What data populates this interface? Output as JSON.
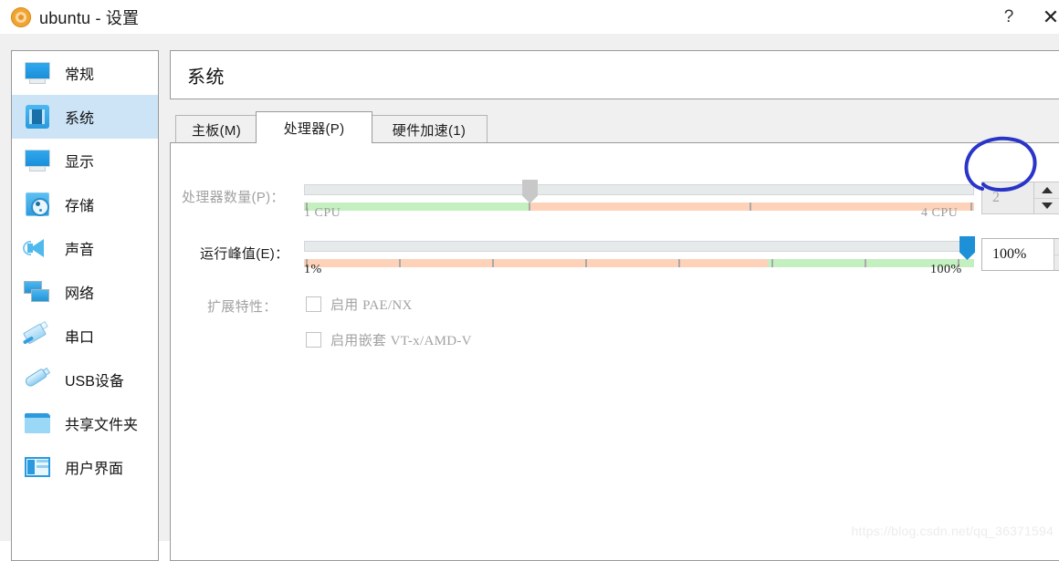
{
  "window": {
    "title": "ubuntu - 设置",
    "icon": "vbox-gear-icon",
    "help_label": "?",
    "close_label": "✕"
  },
  "sidebar": {
    "items": [
      {
        "label": "常规",
        "icon": "monitor-icon",
        "selected": false
      },
      {
        "label": "系统",
        "icon": "cpu-chip-icon",
        "selected": true
      },
      {
        "label": "显示",
        "icon": "monitor-icon",
        "selected": false
      },
      {
        "label": "存储",
        "icon": "hard-disk-icon",
        "selected": false
      },
      {
        "label": "声音",
        "icon": "speaker-icon",
        "selected": false
      },
      {
        "label": "网络",
        "icon": "network-cards-icon",
        "selected": false
      },
      {
        "label": "串口",
        "icon": "serial-port-icon",
        "selected": false
      },
      {
        "label": "USB设备",
        "icon": "usb-icon",
        "selected": false
      },
      {
        "label": "共享文件夹",
        "icon": "folder-icon",
        "selected": false
      },
      {
        "label": "用户界面",
        "icon": "window-layout-icon",
        "selected": false
      }
    ]
  },
  "header": {
    "title": "系统"
  },
  "tabs": [
    {
      "label": "主板(M)",
      "active": false
    },
    {
      "label": "处理器(P)",
      "active": true
    },
    {
      "label": "硬件加速(1)",
      "active": false
    }
  ],
  "main": {
    "cpu_count": {
      "label": "处理器数量(P)：",
      "enabled": false,
      "min_label": "1 CPU",
      "max_label": "4 CPU",
      "value": "2",
      "slider_percent": 33
    },
    "exec_cap": {
      "label": "运行峰值(E)：",
      "enabled": true,
      "min_label": "1%",
      "max_label": "100%",
      "value": "100%",
      "slider_percent": 100
    },
    "extended_features": {
      "label": "扩展特性：",
      "checkboxes": [
        {
          "label_cn": "启用",
          "label_mono": "PAE/NX",
          "checked": false
        },
        {
          "label_cn": "启用嵌套",
          "label_mono": "VT-x/AMD-V",
          "checked": false
        }
      ]
    }
  },
  "annotation": {
    "shape": "hand-drawn-circle",
    "color": "#2a35c8",
    "target": "cpu-count-spinbox"
  },
  "watermark": {
    "text": "https://blog.csdn.net/qq_36371594"
  },
  "colors": {
    "selection": "#cde4f7",
    "slider_green": "#c4f0c0",
    "slider_orange": "#fdd2b8",
    "handle_active": "#1e90d8",
    "handle_disabled": "#c8c8c8"
  }
}
